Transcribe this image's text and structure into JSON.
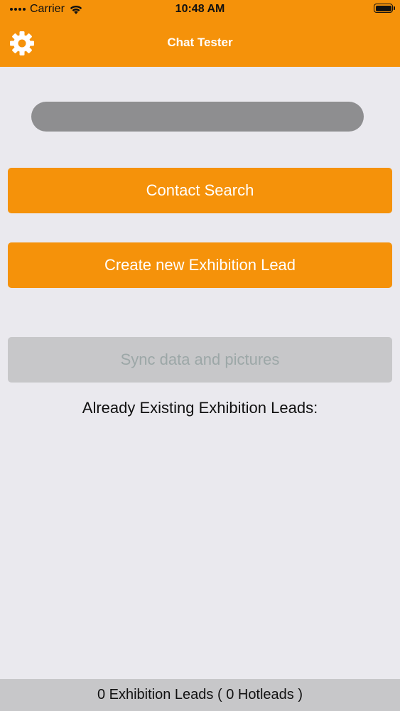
{
  "status_bar": {
    "carrier": "Carrier",
    "time": "10:48 AM",
    "wifi_icon": "wifi-icon",
    "battery_icon": "battery-icon"
  },
  "header": {
    "title": "Chat Tester",
    "settings_icon": "gear-icon",
    "background_color": "#f5920a"
  },
  "progress_bar": {
    "progress": 0
  },
  "buttons": {
    "contact_search": "Contact Search",
    "create_lead": "Create new Exhibition Lead",
    "sync": "Sync data and pictures"
  },
  "existing_leads": {
    "heading": "Already Existing Exhibition Leads:"
  },
  "footer": {
    "summary": "0 Exhibition Leads ( 0 Hotleads )"
  }
}
